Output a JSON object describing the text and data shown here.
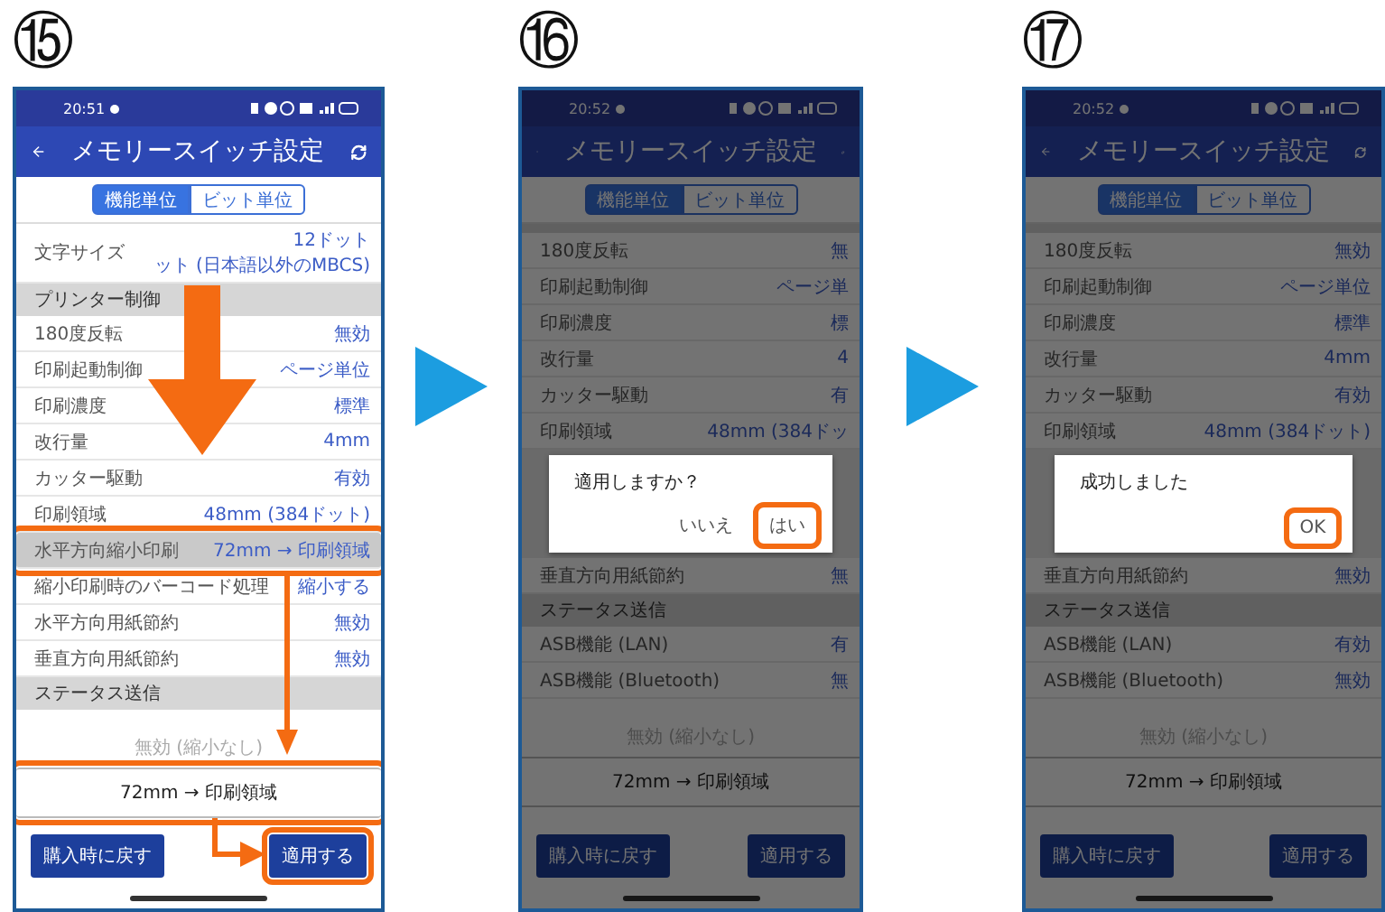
{
  "steps": [
    {
      "number": "⑮",
      "dimmed": false,
      "guide_arrows": true,
      "arrow_after": true,
      "screen": {
        "status_time": "20:51",
        "title": "メモリースイッチ設定",
        "tabs": [
          {
            "label": "機能単位",
            "selected": true
          },
          {
            "label": "ビット単位",
            "selected": false
          }
        ],
        "rows": [
          {
            "kind": "setting",
            "label": "文字サイズ",
            "value": "12ドット",
            "value_continued": "ット (日本語以外のMBCS)",
            "highlighted": false,
            "annotated": false
          },
          {
            "kind": "header",
            "label": "プリンター制御"
          },
          {
            "kind": "setting",
            "label": "180度反転",
            "value": "無効",
            "highlighted": false,
            "annotated": false
          },
          {
            "kind": "setting",
            "label": "印刷起動制御",
            "value": "ページ単位",
            "highlighted": false,
            "annotated": false
          },
          {
            "kind": "setting",
            "label": "印刷濃度",
            "value": "標準",
            "highlighted": false,
            "annotated": false
          },
          {
            "kind": "setting",
            "label": "改行量",
            "value": "4mm",
            "highlighted": false,
            "annotated": false
          },
          {
            "kind": "setting",
            "label": "カッター駆動",
            "value": "有効",
            "highlighted": false,
            "annotated": false
          },
          {
            "kind": "setting",
            "label": "印刷領域",
            "value": "48mm (384ドット)",
            "highlighted": false,
            "annotated": false
          },
          {
            "kind": "setting",
            "label": "水平方向縮小印刷",
            "value": "72mm → 印刷領域",
            "highlighted": true,
            "annotated": true
          },
          {
            "kind": "setting",
            "label": "縮小印刷時のバーコード処理",
            "value": "縮小する",
            "highlighted": false,
            "annotated": false
          },
          {
            "kind": "setting",
            "label": "水平方向用紙節約",
            "value": "無効",
            "highlighted": false,
            "annotated": false
          },
          {
            "kind": "setting",
            "label": "垂直方向用紙節約",
            "value": "無効",
            "highlighted": false,
            "annotated": false
          },
          {
            "kind": "header",
            "label": "ステータス送信"
          }
        ],
        "picker": [
          {
            "label": "無効 (縮小なし)",
            "selected": false,
            "annotated": false
          },
          {
            "label": "72mm → 印刷領域",
            "selected": true,
            "annotated": true
          }
        ],
        "buttons": [
          {
            "label": "購入時に戻す",
            "annotated": false
          },
          {
            "label": "適用する",
            "annotated": true
          }
        ]
      }
    },
    {
      "number": "⑯",
      "dimmed": true,
      "arrow_after": true,
      "screen": {
        "status_time": "20:52",
        "title": "メモリースイッチ設定",
        "tabs": [
          {
            "label": "機能単位",
            "selected": true
          },
          {
            "label": "ビット単位",
            "selected": false
          }
        ],
        "rows": [
          {
            "kind": "partial"
          },
          {
            "kind": "setting",
            "label": "180度反転",
            "value": "無"
          },
          {
            "kind": "setting",
            "label": "印刷起動制御",
            "value": "ページ単"
          },
          {
            "kind": "setting",
            "label": "印刷濃度",
            "value": "標"
          },
          {
            "kind": "setting",
            "label": "改行量",
            "value": "4"
          },
          {
            "kind": "setting",
            "label": "カッター駆動",
            "value": "有"
          },
          {
            "kind": "setting",
            "label": "印刷領域",
            "value": "48mm (384ドッ"
          },
          {
            "kind": "dialog",
            "message": "適用しますか？",
            "buttons": [
              {
                "label": "いいえ",
                "annotated": false
              },
              {
                "label": "はい",
                "annotated": true
              }
            ]
          },
          {
            "kind": "setting",
            "label": "垂直方向用紙節約",
            "value": "無"
          },
          {
            "kind": "header",
            "label": "ステータス送信"
          },
          {
            "kind": "setting",
            "label": "ASB機能 (LAN)",
            "value": "有"
          },
          {
            "kind": "setting",
            "label": "ASB機能 (Bluetooth)",
            "value": "無"
          }
        ],
        "picker": [
          {
            "label": "無効 (縮小なし)",
            "selected": false,
            "annotated": false
          },
          {
            "label": "72mm → 印刷領域",
            "selected": true,
            "annotated": false
          }
        ],
        "buttons": [
          {
            "label": "購入時に戻す",
            "annotated": false
          },
          {
            "label": "適用する",
            "annotated": false
          }
        ]
      }
    },
    {
      "number": "⑰",
      "dimmed": true,
      "screen": {
        "status_time": "20:52",
        "title": "メモリースイッチ設定",
        "tabs": [
          {
            "label": "機能単位",
            "selected": true
          },
          {
            "label": "ビット単位",
            "selected": false
          }
        ],
        "rows": [
          {
            "kind": "partial"
          },
          {
            "kind": "setting",
            "label": "180度反転",
            "value": "無効"
          },
          {
            "kind": "setting",
            "label": "印刷起動制御",
            "value": "ページ単位"
          },
          {
            "kind": "setting",
            "label": "印刷濃度",
            "value": "標準"
          },
          {
            "kind": "setting",
            "label": "改行量",
            "value": "4mm"
          },
          {
            "kind": "setting",
            "label": "カッター駆動",
            "value": "有効"
          },
          {
            "kind": "setting",
            "label": "印刷領域",
            "value": "48mm (384ドット)"
          },
          {
            "kind": "dialog",
            "message": "成功しました",
            "buttons": [
              {
                "label": "OK",
                "annotated": true
              }
            ]
          },
          {
            "kind": "setting",
            "label": "垂直方向用紙節約",
            "value": "無効"
          },
          {
            "kind": "header",
            "label": "ステータス送信"
          },
          {
            "kind": "setting",
            "label": "ASB機能 (LAN)",
            "value": "有効"
          },
          {
            "kind": "setting",
            "label": "ASB機能 (Bluetooth)",
            "value": "無効"
          }
        ],
        "picker": [
          {
            "label": "無効 (縮小なし)",
            "selected": false,
            "annotated": false
          },
          {
            "label": "72mm → 印刷領域",
            "selected": true,
            "annotated": false
          }
        ],
        "buttons": [
          {
            "label": "購入時に戻す",
            "annotated": false
          },
          {
            "label": "適用する",
            "annotated": false
          }
        ]
      }
    }
  ]
}
